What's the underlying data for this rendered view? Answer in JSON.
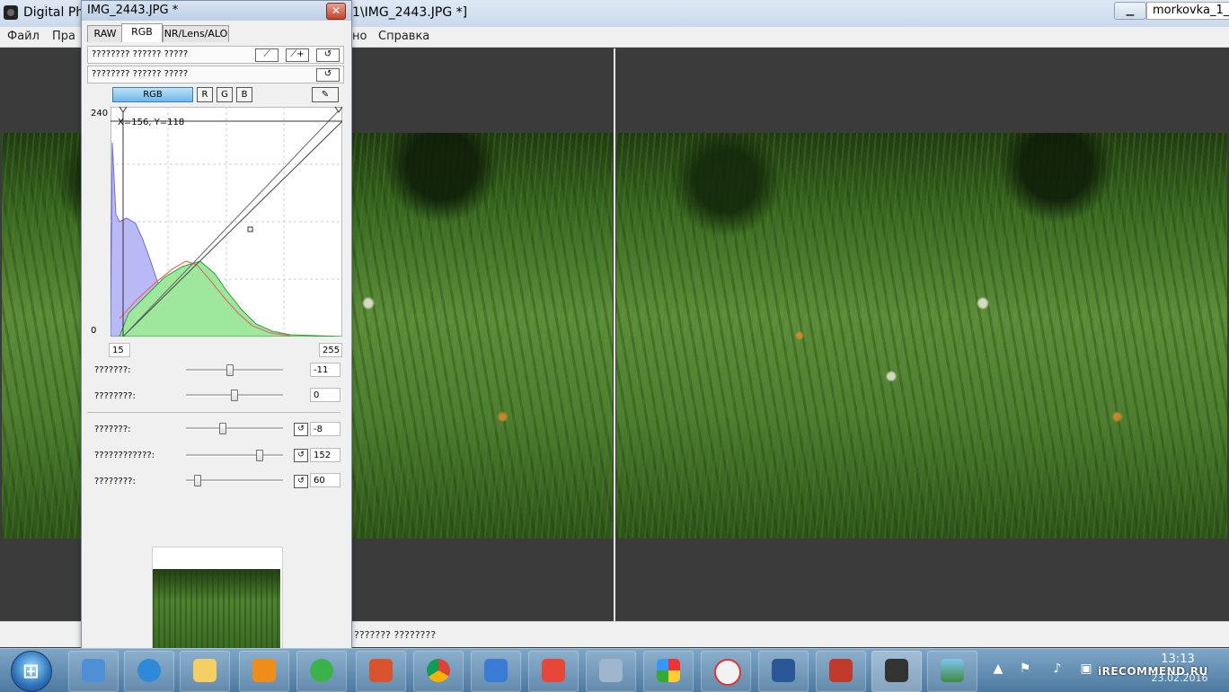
{
  "main_window": {
    "app_title": "Digital Ph",
    "doc_title": "1\\IMG_2443.JPG *]",
    "user": "morkovka_1_"
  },
  "menu": {
    "items": [
      "Файл",
      "Пра",
      "но",
      "Справка"
    ]
  },
  "palette": {
    "title": "IMG_2443.JPG *",
    "close_glyph": "✕",
    "tabs": [
      {
        "label": "RAW",
        "active": false
      },
      {
        "label": "RGB",
        "active": true
      },
      {
        "label": "NR/Lens/ALO",
        "active": false
      }
    ],
    "row1_label": "???????? ?????? ?????",
    "row2_label": "???????? ?????? ?????",
    "channels": {
      "rgb": "RGB",
      "r": "R",
      "g": "G",
      "b": "B"
    },
    "histogram": {
      "axis_max": "240",
      "axis_min": "0",
      "readout": "X=156, Y=118",
      "input_low": "15",
      "input_high": "255"
    },
    "sliders": [
      {
        "label": "???????:",
        "value": "-11",
        "position": 0.45,
        "reset": false
      },
      {
        "label": "????????:",
        "value": "0",
        "position": 0.5,
        "reset": false
      },
      {
        "label": "???????:",
        "value": "-8",
        "position": 0.38,
        "reset": true
      },
      {
        "label": "????????????:",
        "value": "152",
        "position": 0.76,
        "reset": true
      },
      {
        "label": "????????:",
        "value": "60",
        "position": 0.12,
        "reset": true
      }
    ]
  },
  "statusbar": {
    "text": "??????? ????????"
  },
  "taskbar": {
    "clock_time": "13:13",
    "clock_date": "23.02.2016",
    "watermark": "iRECOMMEND.RU"
  },
  "colors": {
    "accent": "#6db7ea",
    "hist_blue": "#b9b9f5",
    "hist_green": "#9ee89e",
    "hist_red": "#e26a6a"
  }
}
